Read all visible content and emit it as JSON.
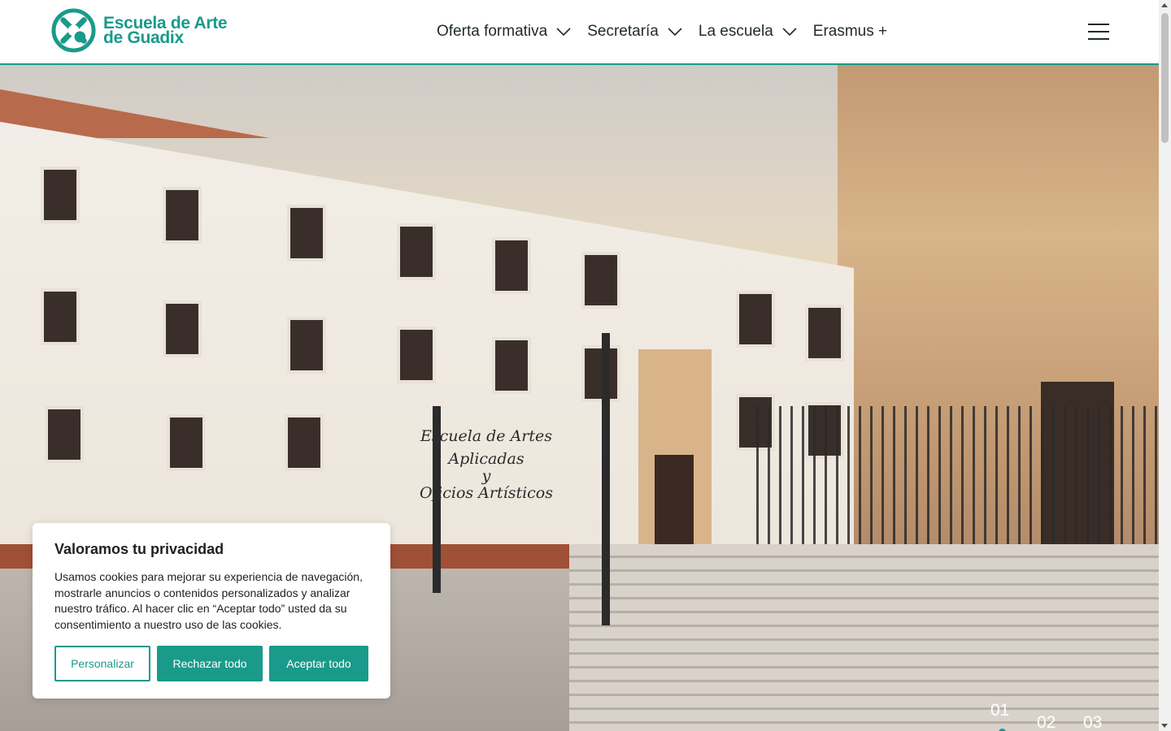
{
  "header": {
    "logo_line1": "Escuela de Arte",
    "logo_line2": "de Guadix",
    "nav": [
      {
        "label": "Oferta formativa",
        "has_dropdown": true
      },
      {
        "label": "Secretaría",
        "has_dropdown": true
      },
      {
        "label": "La escuela",
        "has_dropdown": true
      },
      {
        "label": "Erasmus +",
        "has_dropdown": false
      }
    ],
    "menu_icon": "hamburger-icon"
  },
  "hero": {
    "sign_line1": "Escuela de Artes Aplicadas",
    "sign_line2": "y",
    "sign_line3": "Oficios Artísticos",
    "pager": [
      {
        "label": "01",
        "active": true
      },
      {
        "label": "02",
        "active": false
      },
      {
        "label": "03",
        "active": false
      }
    ]
  },
  "cookie": {
    "title": "Valoramos tu privacidad",
    "text": "Usamos cookies para mejorar su experiencia de navegación, mostrarle anuncios o contenidos personalizados y analizar nuestro tráfico. Al hacer clic en “Aceptar todo” usted da su consentimiento a nuestro uso de las cookies.",
    "btn_customize": "Personalizar",
    "btn_reject": "Rechazar todo",
    "btn_accept": "Aceptar todo"
  },
  "colors": {
    "accent": "#1a9a8a",
    "text": "#1f2a2a"
  }
}
